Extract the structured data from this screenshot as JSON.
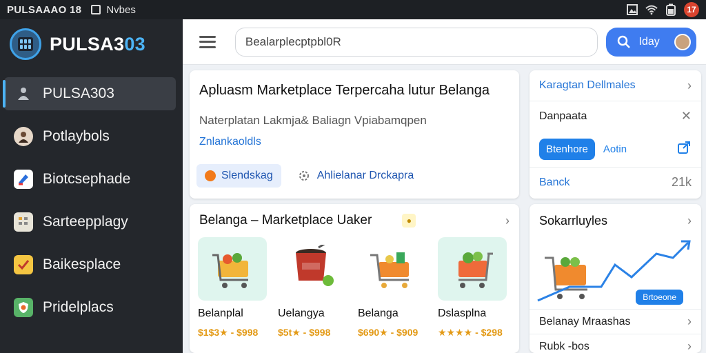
{
  "statusbar": {
    "title": "PULSAAAO 18",
    "app_label": "Nvbes",
    "notification_count": "17"
  },
  "sidebar": {
    "brand_main": "PULSA3",
    "brand_accent": "03",
    "items": [
      {
        "label": "PULSA303",
        "icon": "user-icon",
        "active": true
      },
      {
        "label": "Potlaybols",
        "icon": "avatar-icon"
      },
      {
        "label": "Biotcsephade",
        "icon": "tag-icon"
      },
      {
        "label": "Sarteepplagy",
        "icon": "calendar-icon"
      },
      {
        "label": "Baikesplace",
        "icon": "checklist-icon"
      },
      {
        "label": "Pridelplacs",
        "icon": "shield-icon"
      }
    ]
  },
  "topbar": {
    "search_value": "Bealarplecptpbl0R",
    "search_button_label": "Iday"
  },
  "hero": {
    "title": "Apluasm Marketplace Terpercaha lutur Belanga",
    "subtitle": "Naterplatan Lakmja& Baliagn Vpiabamqpen",
    "link": "Znlankaoldls",
    "chip_label": "Slendskag",
    "secondary_label": "Ahlielanar Drckapra"
  },
  "right_card": {
    "top_link": "Karagtan Dellmales",
    "title": "Danpaata",
    "primary_button": "Btenhore",
    "text_button": "Aotin",
    "footer_link": "Banck",
    "footer_value": "21k"
  },
  "market": {
    "title": "Belanga – Marketplace Uaker",
    "products": [
      {
        "name": "Belanplal",
        "price": "$1$3★ - $998",
        "bg": "#dff5ee",
        "icon": "shopping-cart-icon"
      },
      {
        "name": "Uelangya",
        "price": "$5t★ - $998",
        "bg": "#ffffff",
        "icon": "pulsa-bag-icon"
      },
      {
        "name": "Belanga",
        "price": "$690★ - $909",
        "bg": "#ffffff",
        "icon": "shopping-cart-icon"
      },
      {
        "name": "Dslasplna",
        "price": "★★★★ - $298",
        "bg": "#dff5ee",
        "icon": "shopping-cart-icon"
      }
    ]
  },
  "right_card2": {
    "title": "Sokarrluyles",
    "badge": "Brtoeone",
    "row1": "Belanay Mraashas",
    "row2": "Rubk -bos"
  },
  "colors": {
    "accent": "#4cb3f5",
    "primary": "#3f7cf0",
    "price": "#e39a16"
  }
}
